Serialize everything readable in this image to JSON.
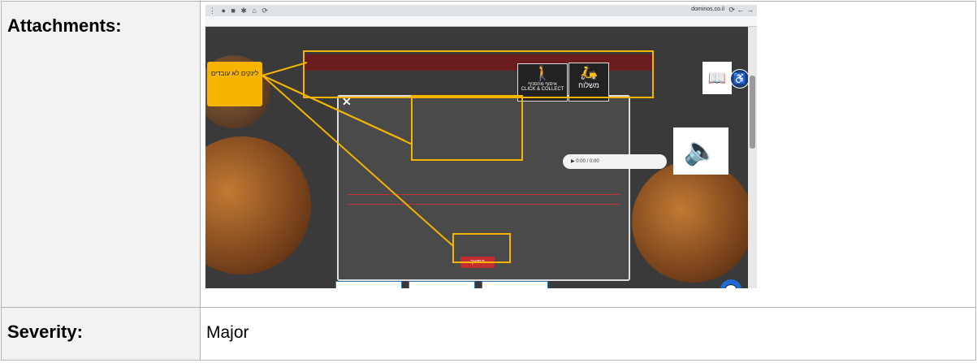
{
  "rows": [
    {
      "label": "Attachments:",
      "value": ""
    },
    {
      "label": "Severity:",
      "value": "Major"
    }
  ],
  "screenshot": {
    "callout": "לינקים לא עובדים",
    "delivery_label": "משלוח",
    "pickup_label": "איסוף מהסניף",
    "pickup_sub": "CLICK & COLLECT",
    "audio_time": "0:00 / 0:00",
    "continue_label": "המשך",
    "url": "dominos.co.il"
  },
  "colors": {
    "highlight": "#f4b400",
    "label_bg": "#f2f2f2",
    "border": "#b4b4b4"
  }
}
